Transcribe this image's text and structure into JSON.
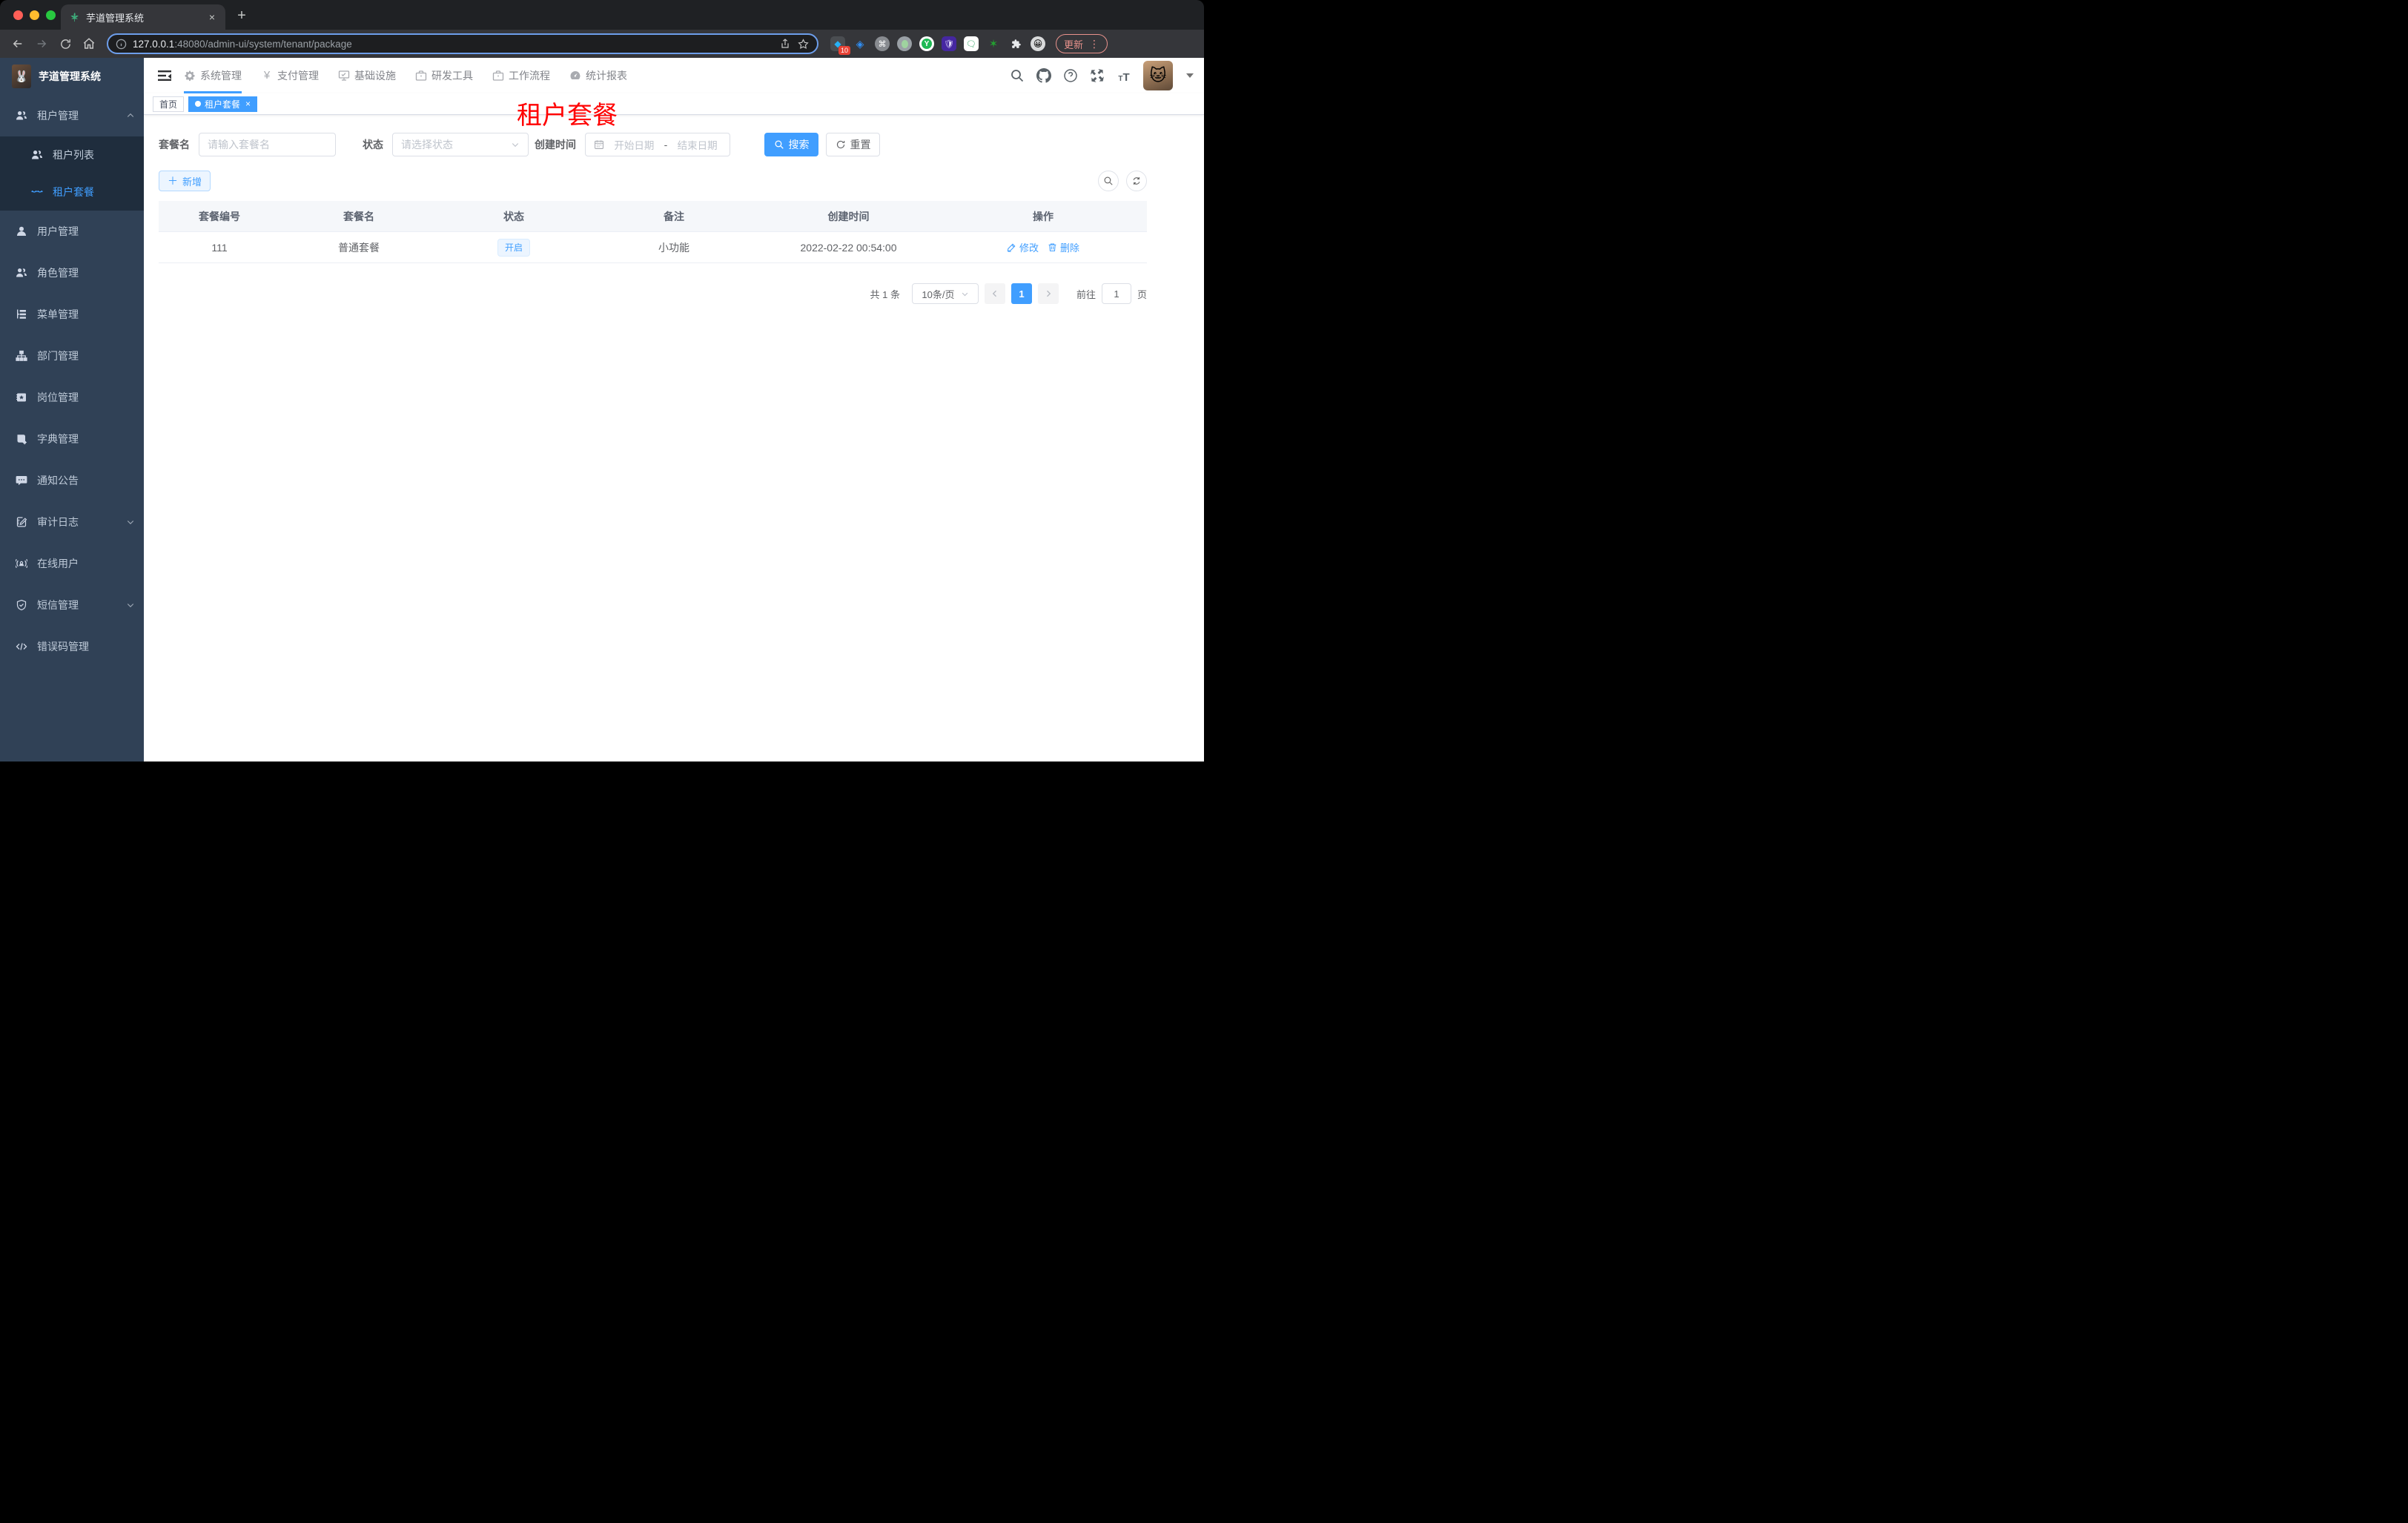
{
  "browser": {
    "tab_title": "芋道管理系统",
    "url_host": "127.0.0.1",
    "url_rest": ":48080/admin-ui/system/tenant/package",
    "update_label": "更新",
    "extension_badge": "10"
  },
  "sidebar": {
    "title": "芋道管理系统",
    "tenant_group": "租户管理",
    "tenant_children": [
      "租户列表",
      "租户套餐"
    ],
    "items": [
      "用户管理",
      "角色管理",
      "菜单管理",
      "部门管理",
      "岗位管理",
      "字典管理",
      "通知公告",
      "审计日志",
      "在线用户",
      "短信管理",
      "错误码管理"
    ]
  },
  "top_nav": [
    "系统管理",
    "支付管理",
    "基础设施",
    "研发工具",
    "工作流程",
    "统计报表"
  ],
  "tags": {
    "home": "首页",
    "active": "租户套餐"
  },
  "annotation": {
    "text": "租户套餐",
    "color": "#ff0000"
  },
  "query": {
    "name_label": "套餐名",
    "name_placeholder": "请输入套餐名",
    "status_label": "状态",
    "status_placeholder": "请选择状态",
    "time_label": "创建时间",
    "start_placeholder": "开始日期",
    "separator": "-",
    "end_placeholder": "结束日期",
    "search_label": "搜索",
    "reset_label": "重置",
    "add_label": "新增"
  },
  "table": {
    "headers": [
      "套餐编号",
      "套餐名",
      "状态",
      "备注",
      "创建时间",
      "操作"
    ],
    "rows": [
      {
        "id": "111",
        "name": "普通套餐",
        "status": "开启",
        "remark": "小功能",
        "create_time": "2022-02-22 00:54:00",
        "edit": "修改",
        "delete": "删除"
      }
    ]
  },
  "pagination": {
    "total": "共 1 条",
    "size": "10条/页",
    "page": "1",
    "goto": "前往",
    "goto_value": "1",
    "unit": "页"
  }
}
